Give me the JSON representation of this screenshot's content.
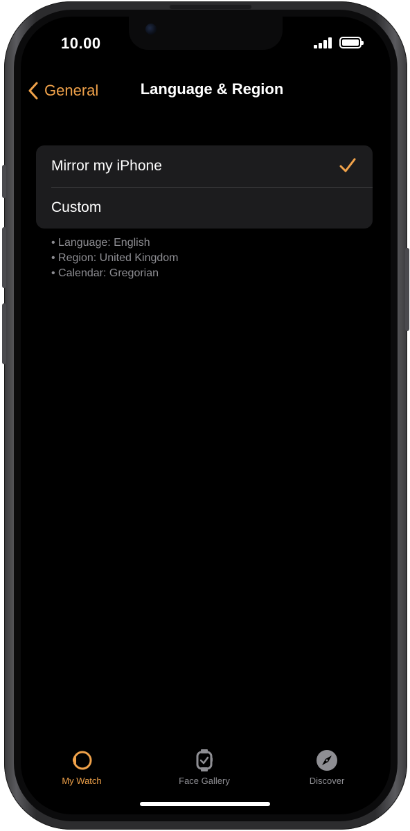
{
  "status_bar": {
    "time": "10.00"
  },
  "nav": {
    "back_label": "General",
    "title": "Language & Region"
  },
  "options": [
    {
      "label": "Mirror my iPhone",
      "selected": true
    },
    {
      "label": "Custom",
      "selected": false
    }
  ],
  "details": [
    "• Language: English",
    "• Region: United Kingdom",
    "• Calendar: Gregorian"
  ],
  "tabs": [
    {
      "label": "My Watch",
      "icon": "watch-icon",
      "active": true
    },
    {
      "label": "Face Gallery",
      "icon": "watch-face-icon",
      "active": false
    },
    {
      "label": "Discover",
      "icon": "compass-icon",
      "active": false
    }
  ],
  "colors": {
    "accent": "#f0a24a",
    "inactive": "#8e8e93",
    "background": "#000000",
    "cell": "#1c1c1e"
  }
}
